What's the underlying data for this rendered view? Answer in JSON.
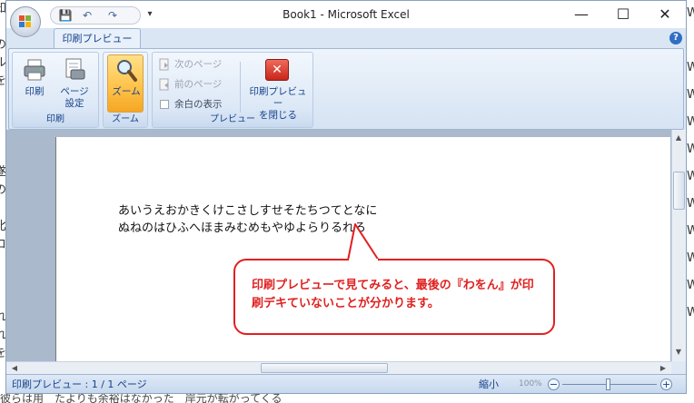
{
  "window": {
    "title": "Book1 - Microsoft Excel",
    "minimize_glyph": "—",
    "maximize_glyph": "☐",
    "close_glyph": "✕"
  },
  "qat": {
    "save_glyph": "💾",
    "undo_glyph": "↶",
    "redo_glyph": "↷",
    "customize_glyph": "▾"
  },
  "tab": {
    "label": "印刷プレビュー"
  },
  "help_glyph": "?",
  "ribbon": {
    "print_group": {
      "label": "印刷",
      "print_label": "印刷",
      "page_setup_label": "ページ\n設定"
    },
    "zoom_group": {
      "label": "ズーム",
      "zoom_label": "ズーム"
    },
    "preview_group": {
      "label": "プレビュー",
      "next_page_label": "次のページ",
      "prev_page_label": "前のページ",
      "show_margins_label": "余白の表示",
      "close_preview_label": "印刷プレビュー\nを閉じる",
      "close_preview_glyph": "✕"
    }
  },
  "document": {
    "line1": "あいうえおかきくけこさしすせそたちつてとなに",
    "line2": "ぬねのはひふへほまみむめもやゆよらりるれろ"
  },
  "callout": {
    "text": "印刷プレビューで見てみると、最後の『わをん』が印刷デキていないことが分かります。"
  },
  "statusbar": {
    "status": "印刷プレビュー : 1 / 1 ページ",
    "zoom_out_label": "縮小",
    "zoom_percent": "100%",
    "minus_glyph": "−",
    "plus_glyph": "+"
  },
  "background_text": {
    "left_chars": [
      "知",
      "!",
      "の",
      "ル",
      "を",
      "",
      "",
      "",
      "",
      "遂",
      "の",
      "",
      "比",
      "コ",
      "",
      "",
      "",
      "れ",
      "れ",
      "を",
      "",
      "",
      "か"
    ],
    "bottom_line": "彼らは用　たよりも余裕はなかった　岸元が転がってくる"
  },
  "colors": {
    "ribbon_accent": "#15428b",
    "callout_red": "#e02020",
    "zoom_active": "#ffc44c"
  }
}
